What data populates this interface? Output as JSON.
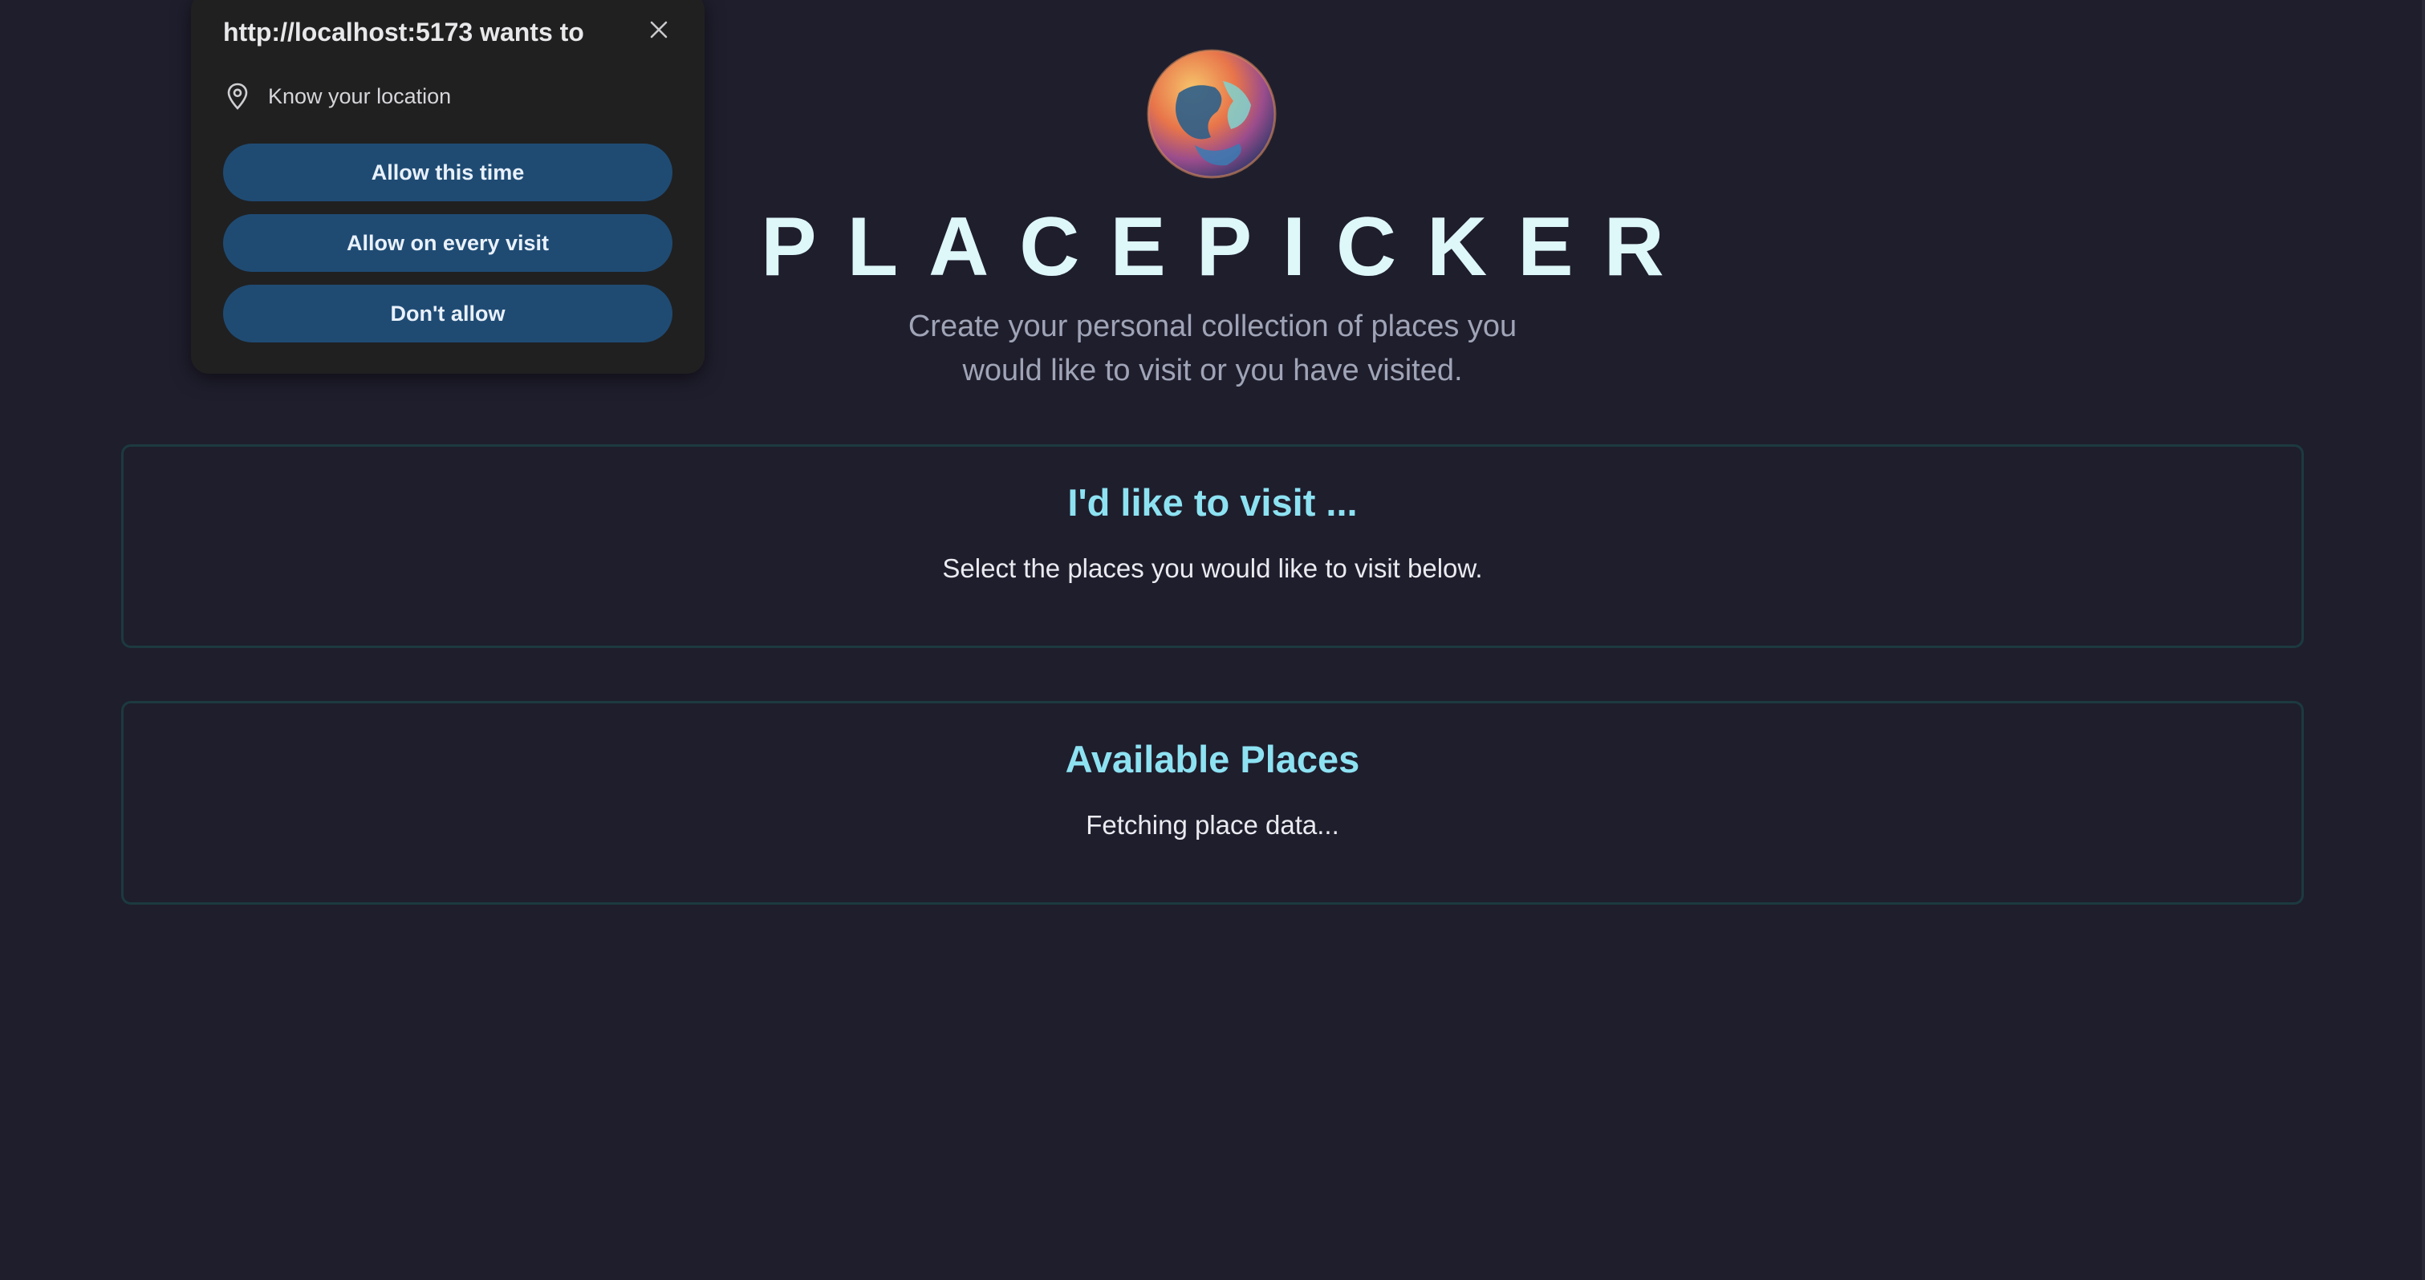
{
  "popup": {
    "title": "http://localhost:5173 wants to",
    "permission_label": "Know your location",
    "buttons": {
      "allow_once": "Allow this time",
      "allow_always": "Allow on every visit",
      "deny": "Don't allow"
    },
    "button_color": "#1f4b73"
  },
  "header": {
    "logo": "globe-logo",
    "title": "PLACEPICKER",
    "subtitle_line1": "Create your personal collection of places you",
    "subtitle_line2": "would like to visit or you have visited."
  },
  "sections": {
    "visit": {
      "heading": "I'd like to visit ...",
      "body": "Select the places you would like to visit below."
    },
    "available": {
      "heading": "Available Places",
      "body": "Fetching place data..."
    }
  },
  "colors": {
    "background": "#1f1e2d",
    "heading_accent": "#8de2f2",
    "title": "#def7f9",
    "section_border": "#1c3a40"
  }
}
